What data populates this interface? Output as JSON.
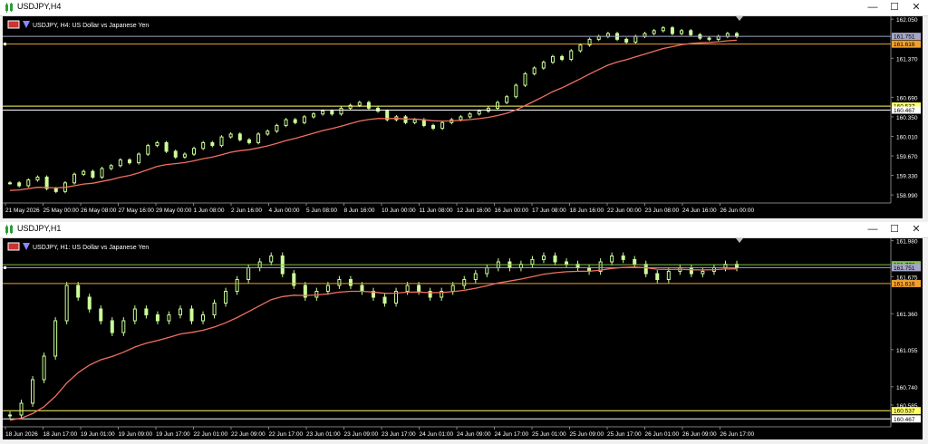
{
  "windows": [
    {
      "title": "USDJPY,H4",
      "header": "USDJPY, H4:  US Dollar vs Japanese Yen",
      "price_labels": [
        "162.050",
        "161.370",
        "160.690",
        "160.350",
        "160.010",
        "159.670",
        "159.330",
        "158.990"
      ],
      "time_labels": [
        "21 May 2026",
        "25 May 00:00",
        "26 May 08:00",
        "27 May 16:00",
        "29 May 00:00",
        "1 Jun 08:00",
        "2 Jun 16:00",
        "4 Jun 00:00",
        "5 Jun 08:00",
        "8 Jun 16:00",
        "10 Jun 00:00",
        "11 Jun 08:00",
        "12 Jun 16:00",
        "16 Jun 00:00",
        "17 Jun 08:00",
        "18 Jun 16:00",
        "22 Jun 00:00",
        "23 Jun 08:00",
        "24 Jun 16:00",
        "26 Jun 00:00"
      ],
      "markers": [
        {
          "value": 161.751,
          "label": "161.751",
          "color": "#a6a6c8",
          "text": "#000000"
        },
        {
          "value": 161.616,
          "label": "161.616",
          "color": "#f0a030",
          "text": "#000000"
        },
        {
          "value": 160.537,
          "label": "160.537",
          "color": "#ffff66",
          "text": "#000000"
        },
        {
          "value": 160.467,
          "label": "160.467",
          "color": "#ffffff",
          "text": "#000000"
        }
      ]
    },
    {
      "title": "USDJPY,H1",
      "header": "USDJPY, H1:  US Dollar vs Japanese Yen",
      "price_labels": [
        "161.980",
        "161.675",
        "161.360",
        "161.055",
        "160.740",
        "160.585"
      ],
      "time_labels": [
        "18 Jun 2026",
        "18 Jun 17:00",
        "19 Jun 01:00",
        "19 Jun 09:00",
        "19 Jun 17:00",
        "22 Jun 01:00",
        "22 Jun 09:00",
        "22 Jun 17:00",
        "23 Jun 01:00",
        "23 Jun 09:00",
        "23 Jun 17:00",
        "24 Jun 01:00",
        "24 Jun 09:00",
        "24 Jun 17:00",
        "25 Jun 01:00",
        "25 Jun 09:00",
        "25 Jun 17:00",
        "26 Jun 01:00",
        "26 Jun 09:00",
        "26 Jun 17:00"
      ],
      "markers": [
        {
          "value": 161.776,
          "label": "161.776",
          "color": "#7fbf4f",
          "text": "#000000"
        },
        {
          "value": 161.751,
          "label": "161.751",
          "color": "#a6a6c8",
          "text": "#000000"
        },
        {
          "value": 161.616,
          "label": "161.616",
          "color": "#f0a030",
          "text": "#000000"
        },
        {
          "value": 160.537,
          "label": "160.537",
          "color": "#ffff66",
          "text": "#000000"
        },
        {
          "value": 160.467,
          "label": "160.467",
          "color": "#ffffff",
          "text": "#000000"
        }
      ]
    }
  ],
  "chart_data": [
    {
      "type": "candlestick",
      "symbol": "USDJPY",
      "timeframe": "H4",
      "ylim": [
        158.85,
        162.1
      ],
      "candle_color": "#ccff99",
      "ma_color": "#f07060",
      "close": [
        159.2,
        159.15,
        159.25,
        159.3,
        159.1,
        159.05,
        159.2,
        159.35,
        159.4,
        159.3,
        159.45,
        159.5,
        159.6,
        159.55,
        159.7,
        159.85,
        159.9,
        159.75,
        159.65,
        159.7,
        159.8,
        159.9,
        159.85,
        160.0,
        160.05,
        159.95,
        159.9,
        160.05,
        160.1,
        160.2,
        160.3,
        160.25,
        160.35,
        160.4,
        160.45,
        160.4,
        160.5,
        160.55,
        160.6,
        160.5,
        160.45,
        160.3,
        160.35,
        160.25,
        160.3,
        160.2,
        160.15,
        160.25,
        160.3,
        160.35,
        160.4,
        160.45,
        160.5,
        160.6,
        160.7,
        160.9,
        161.1,
        161.2,
        161.3,
        161.4,
        161.35,
        161.5,
        161.6,
        161.7,
        161.75,
        161.8,
        161.7,
        161.65,
        161.75,
        161.8,
        161.85,
        161.9,
        161.8,
        161.85,
        161.78,
        161.72,
        161.7,
        161.75,
        161.8,
        161.75
      ],
      "ma_start": 159.05,
      "ma_end": 161.7,
      "lines": [
        161.751,
        161.616,
        160.537,
        160.467
      ]
    },
    {
      "type": "candlestick",
      "symbol": "USDJPY",
      "timeframe": "H1",
      "ylim": [
        160.4,
        162.0
      ],
      "candle_color": "#ccff99",
      "ma_color": "#f07060",
      "close": [
        160.5,
        160.6,
        160.8,
        161.0,
        161.3,
        161.6,
        161.5,
        161.4,
        161.3,
        161.2,
        161.3,
        161.4,
        161.35,
        161.3,
        161.35,
        161.4,
        161.3,
        161.35,
        161.45,
        161.55,
        161.65,
        161.75,
        161.8,
        161.85,
        161.7,
        161.6,
        161.5,
        161.55,
        161.6,
        161.65,
        161.6,
        161.55,
        161.5,
        161.45,
        161.55,
        161.6,
        161.55,
        161.5,
        161.55,
        161.6,
        161.65,
        161.7,
        161.75,
        161.8,
        161.75,
        161.78,
        161.82,
        161.85,
        161.8,
        161.78,
        161.75,
        161.72,
        161.8,
        161.85,
        161.82,
        161.78,
        161.7,
        161.65,
        161.72,
        161.75,
        161.7,
        161.72,
        161.75,
        161.78,
        161.75
      ],
      "ma_start": 160.45,
      "ma_end": 161.68,
      "lines": [
        161.776,
        161.751,
        161.616,
        160.537,
        160.467
      ]
    }
  ]
}
